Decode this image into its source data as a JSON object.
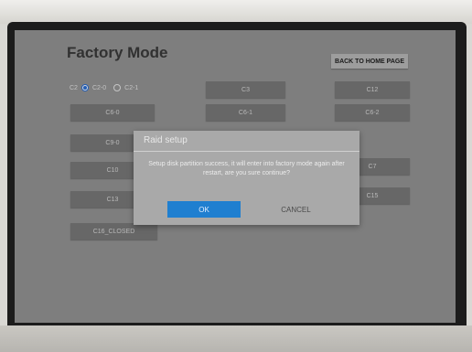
{
  "screen": {
    "title": "Factory Mode",
    "home_button": "BACK TO HOME PAGE",
    "radio_group": {
      "label": "C2",
      "options": [
        {
          "label": "C2-0",
          "selected": true
        },
        {
          "label": "C2-1",
          "selected": false
        }
      ]
    },
    "buttons": {
      "c3": "C3",
      "c12": "C12",
      "c6_0": "C6-0",
      "c6_1": "C6-1",
      "c6_2": "C6-2",
      "c9_0": "C9-0",
      "c10": "C10",
      "c7": "C7",
      "c13": "C13",
      "c15": "C15",
      "c16_closed": "C16_CLOSED"
    }
  },
  "dialog": {
    "title": "Raid setup",
    "message": "Setup disk partition success, it will enter into factory mode again after restart, are you sure continue?",
    "ok_label": "OK",
    "cancel_label": "CANCEL"
  },
  "colors": {
    "screen_bg": "#949494",
    "button_bg": "#7a7a7a",
    "ok_button": "#1f7fd0",
    "dialog_bg": "#a9a9a9"
  }
}
